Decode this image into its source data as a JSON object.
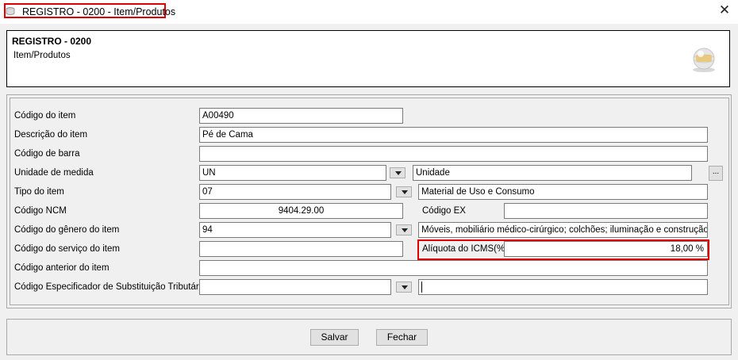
{
  "window": {
    "title": "REGISTRO - 0200 - Item/Produtos",
    "close_glyph": "✕",
    "app_icon": "database-icon"
  },
  "header": {
    "title": "REGISTRO - 0200",
    "subtitle": "Item/Produtos",
    "logo_icon": "globe-logo-icon"
  },
  "form": {
    "codigo_item": {
      "label": "Código do item",
      "value": "A00490"
    },
    "descricao_item": {
      "label": "Descrição do item",
      "value": "Pé de Cama"
    },
    "codigo_barra": {
      "label": "Código de barra",
      "value": ""
    },
    "unidade_medida": {
      "label": "Unidade de medida",
      "code": "UN",
      "description": "Unidade",
      "browse_label": "..."
    },
    "tipo_item": {
      "label": "Tipo do item",
      "code": "07",
      "description": "Material de Uso e Consumo"
    },
    "codigo_ncm": {
      "label": "Código NCM",
      "value": "9404.29.00"
    },
    "codigo_ex": {
      "label": "Código EX",
      "value": ""
    },
    "codigo_genero": {
      "label": "Código do gênero do item",
      "code": "94",
      "description": "Móveis, mobiliário médico-cirúrgico; colchões; iluminação e construção pré"
    },
    "codigo_servico": {
      "label": "Código do serviço do item",
      "value": ""
    },
    "aliquota_icms": {
      "label": "Alíquota do ICMS(%)",
      "value": "18,00 %"
    },
    "codigo_anterior": {
      "label": "Código anterior do item",
      "value": ""
    },
    "codigo_especificador": {
      "label": "Código Especificador de Substituição Tributária",
      "code": "",
      "description": ""
    }
  },
  "buttons": {
    "save": "Salvar",
    "close": "Fechar"
  },
  "colors": {
    "highlight": "#e00000",
    "background": "#f0f0f0"
  }
}
